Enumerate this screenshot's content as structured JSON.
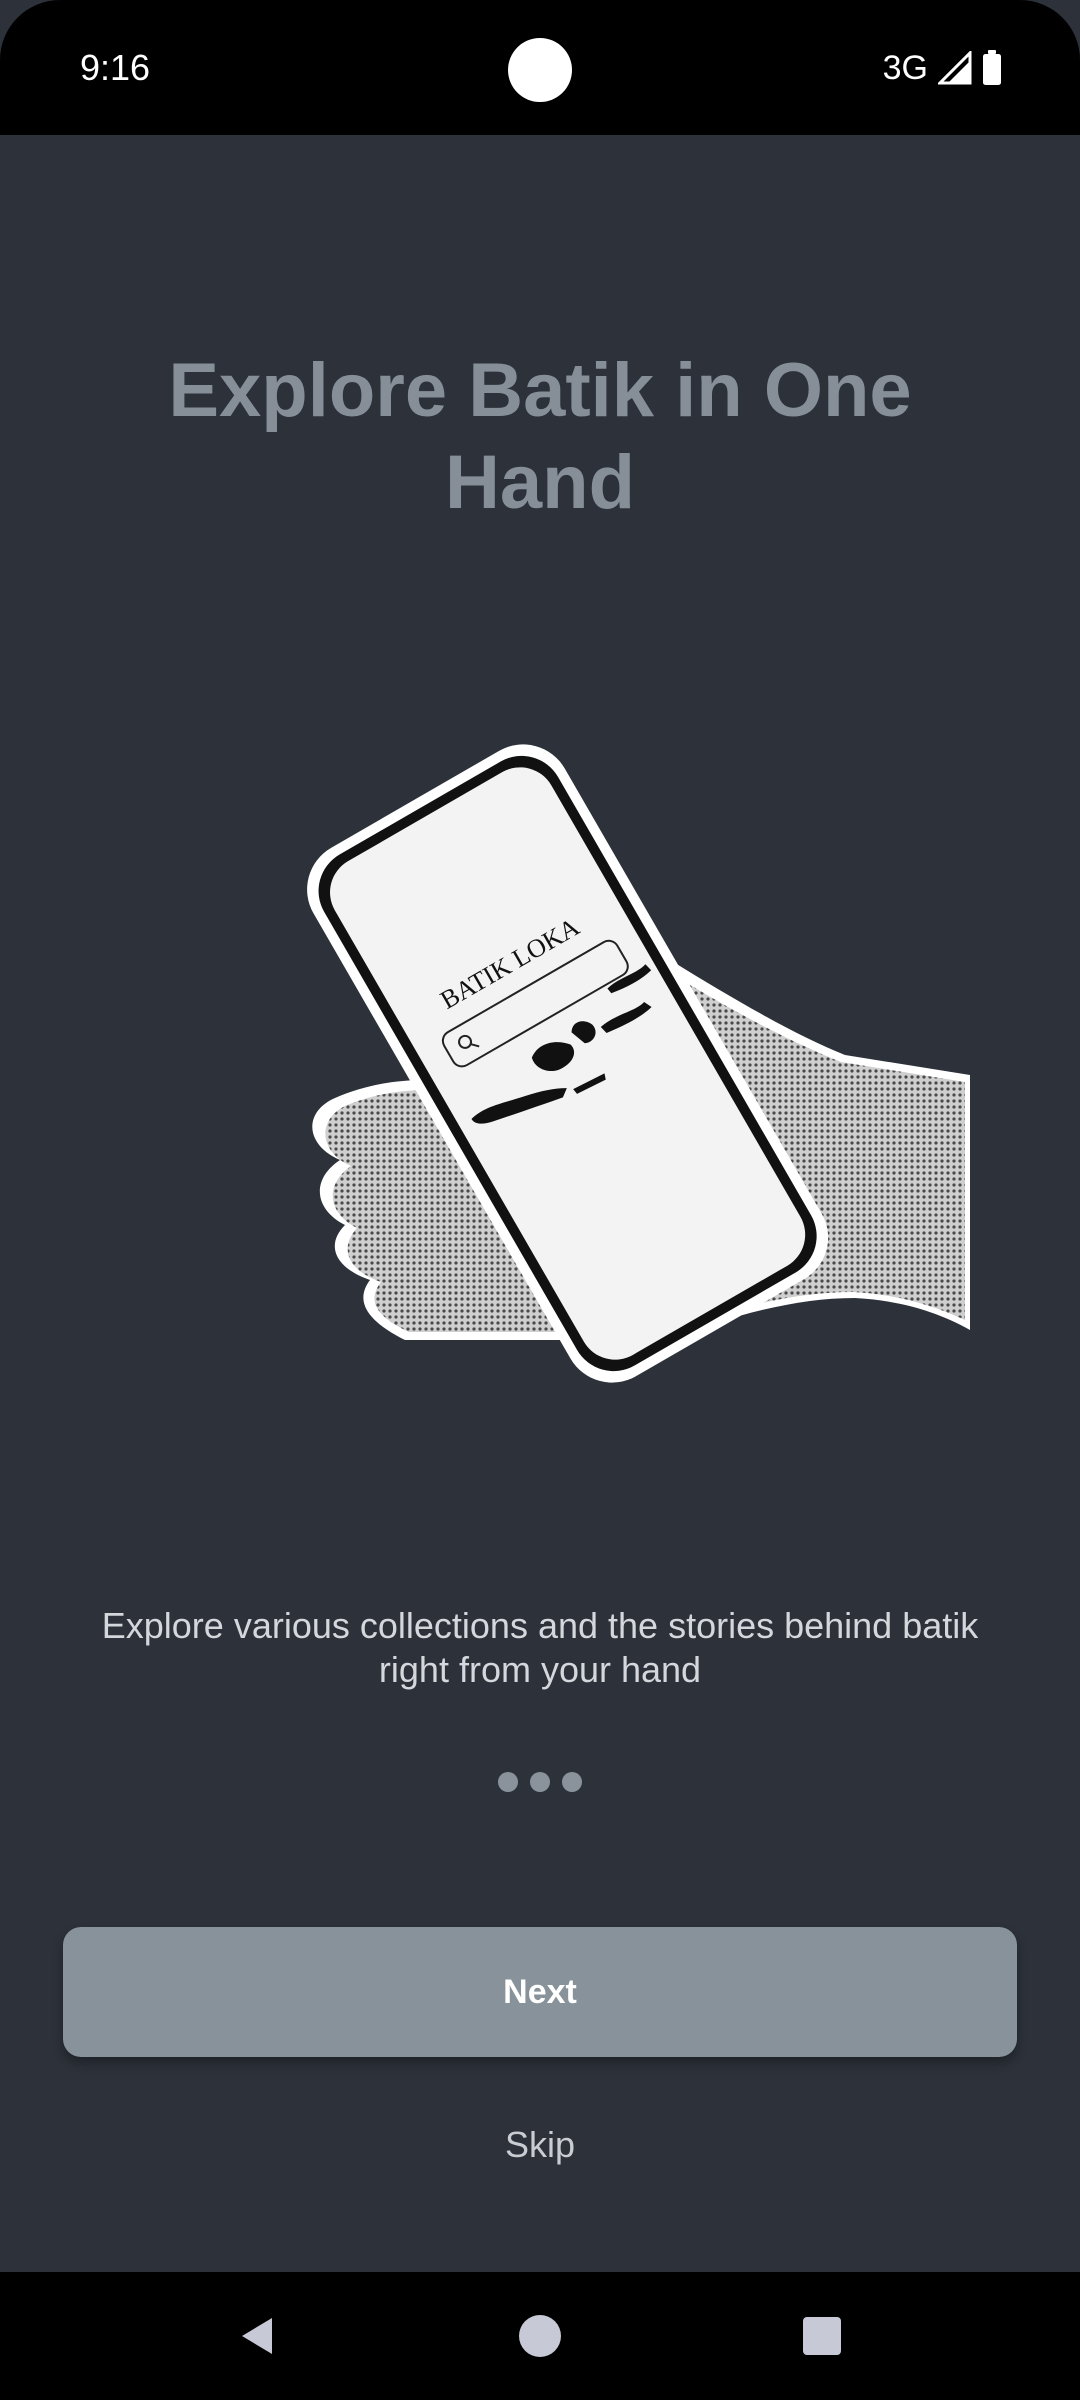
{
  "status_bar": {
    "time": "9:16",
    "network": "3G",
    "icons": [
      "signal-icon",
      "battery-icon"
    ]
  },
  "onboarding": {
    "title": "Explore Batik in One Hand",
    "illustration": {
      "app_name_on_phone": "BATIK LOKA",
      "icons": [
        "search-icon",
        "indonesia-map"
      ]
    },
    "description": "Explore various collections and the stories behind batik right from your hand",
    "page_indicator": {
      "count": 3
    },
    "next_label": "Next",
    "skip_label": "Skip"
  },
  "nav_bar": {
    "icons": [
      "back-icon",
      "home-icon",
      "recents-icon"
    ]
  },
  "colors": {
    "background": "#2c313a",
    "title": "#868f98",
    "button": "#87929b",
    "text_light": "#d4d7dc"
  }
}
